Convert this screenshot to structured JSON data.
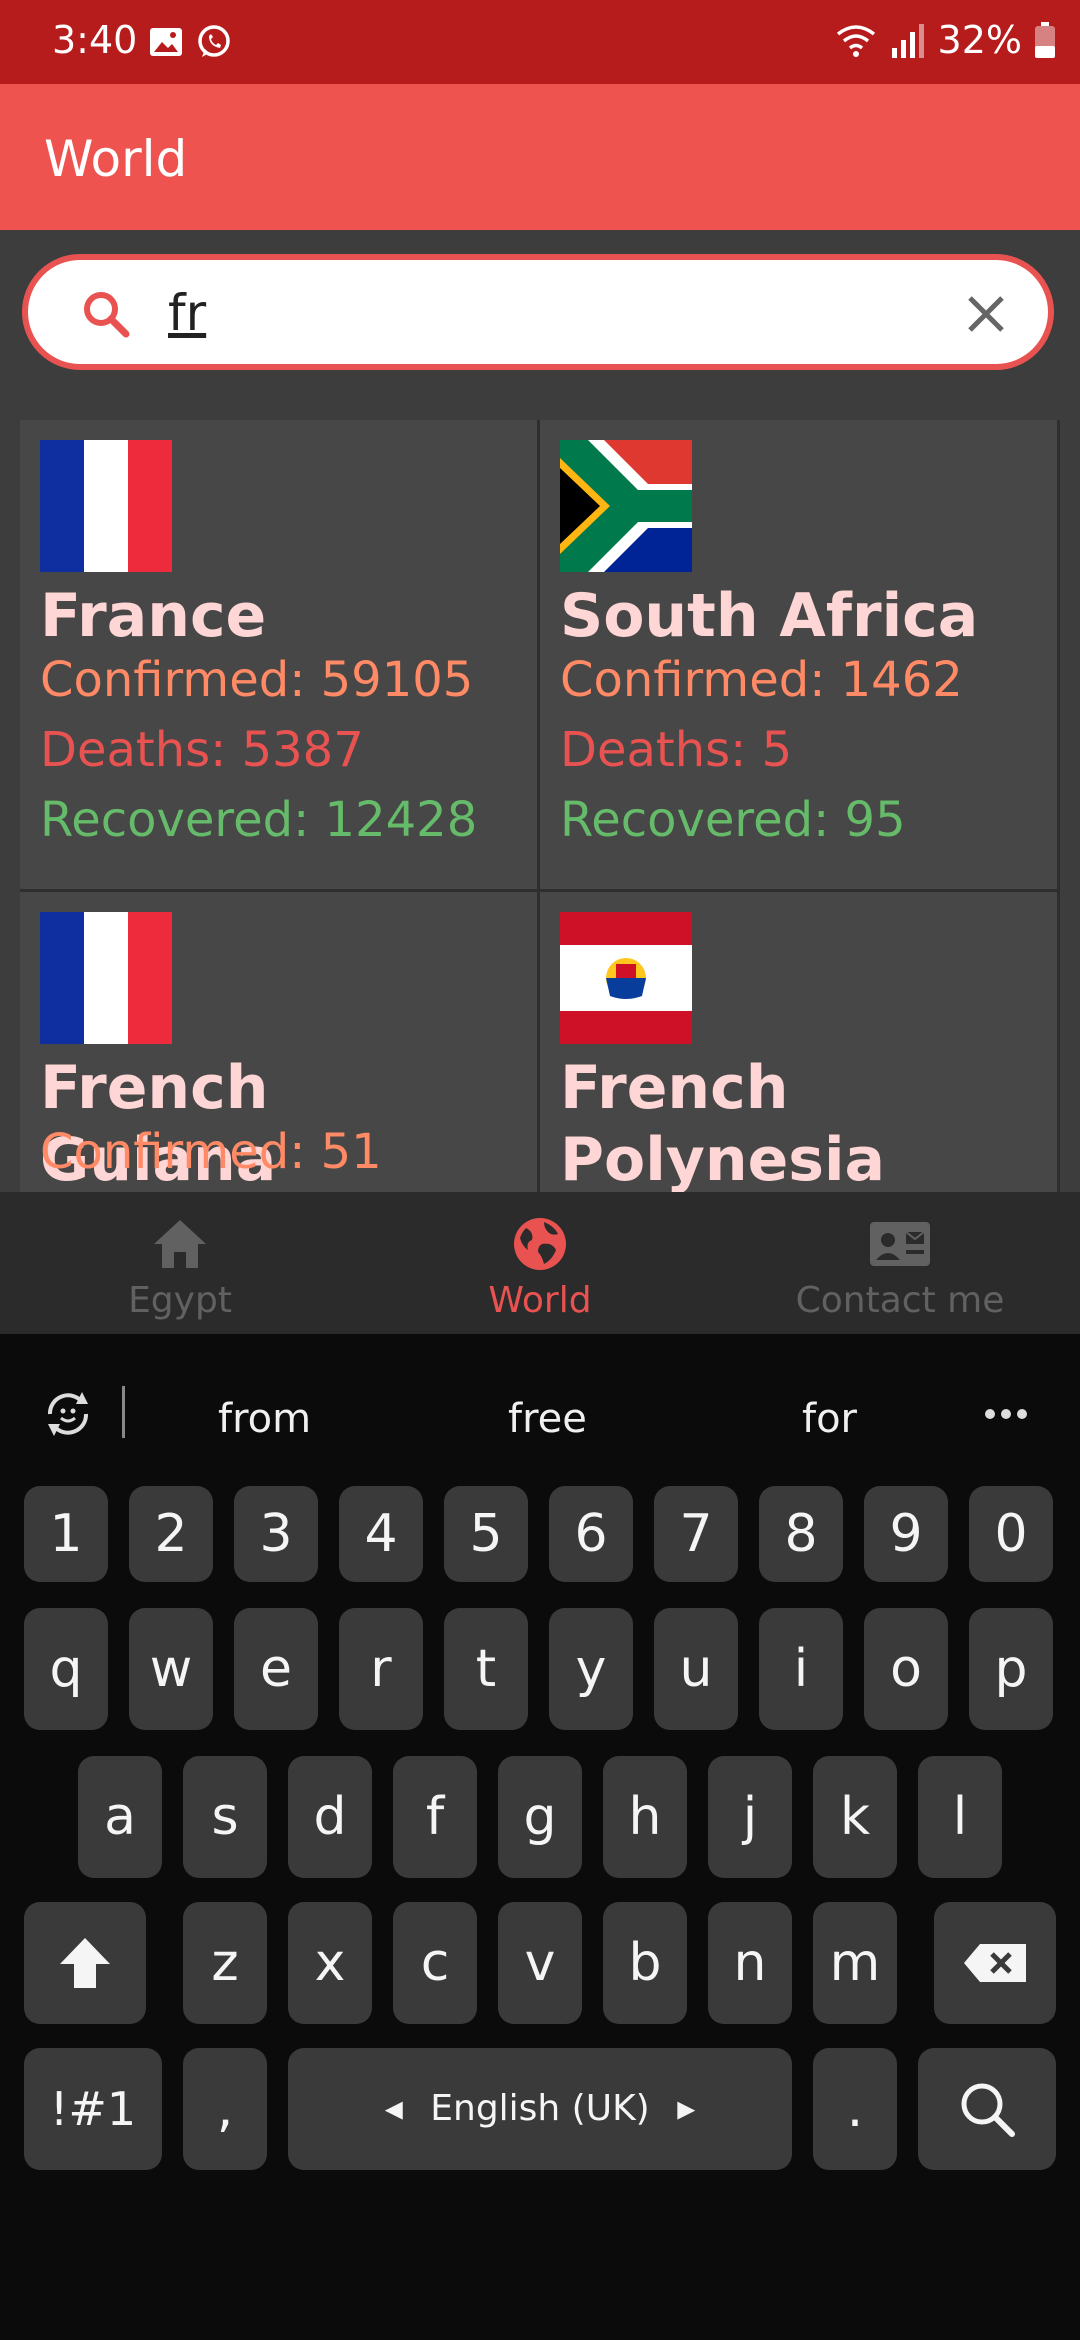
{
  "status_bar": {
    "time": "3:40",
    "battery": "32%"
  },
  "app_bar": {
    "title": "World"
  },
  "search": {
    "value": "fr",
    "placeholder": ""
  },
  "countries": [
    {
      "name": "France",
      "confirmed": "Confirmed: 59105",
      "deaths": "Deaths: 5387",
      "recovered": "Recovered: 12428"
    },
    {
      "name": "South Africa",
      "confirmed": "Confirmed: 1462",
      "deaths": "Deaths: 5",
      "recovered": "Recovered: 95"
    },
    {
      "name": "French Guiana",
      "confirmed": "Confirmed: 51"
    },
    {
      "name": "French Polynesia"
    }
  ],
  "bottom_nav": {
    "items": [
      {
        "label": "Egypt",
        "icon": "home-icon"
      },
      {
        "label": "World",
        "icon": "globe-icon",
        "active": true
      },
      {
        "label": "Contact me",
        "icon": "contact-card-icon"
      }
    ],
    "active_color": "#e85351",
    "inactive_color": "#616161"
  },
  "keyboard": {
    "suggestions": [
      "from",
      "free",
      "for"
    ],
    "number_row": [
      "1",
      "2",
      "3",
      "4",
      "5",
      "6",
      "7",
      "8",
      "9",
      "0"
    ],
    "row1": [
      "q",
      "w",
      "e",
      "r",
      "t",
      "y",
      "u",
      "i",
      "o",
      "p"
    ],
    "row2": [
      "a",
      "s",
      "d",
      "f",
      "g",
      "h",
      "j",
      "k",
      "l"
    ],
    "row3": [
      "z",
      "x",
      "c",
      "v",
      "b",
      "n",
      "m"
    ],
    "symbols_label": "!#1",
    "comma_label": ",",
    "space_label": "English (UK)",
    "period_label": "."
  },
  "colors": {
    "status_bar": "#b71c1c",
    "app_bar": "#ef5350",
    "accent": "#e85351",
    "confirmed": "#ff8a65",
    "deaths": "#e85351",
    "recovered": "#66bb6a"
  }
}
